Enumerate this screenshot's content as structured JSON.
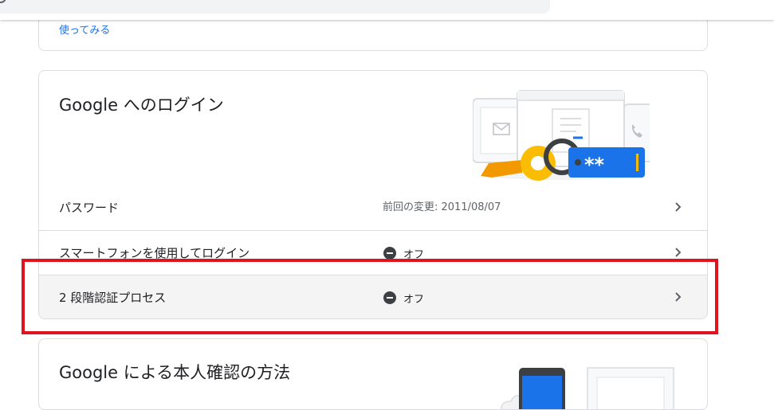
{
  "top_card": {
    "link_label": "使ってみる"
  },
  "signin_card": {
    "title": "Google へのログイン",
    "illustration_icons": [
      "mail-icon",
      "document-icon",
      "phone-icon",
      "key-icon",
      "password-field-icon"
    ],
    "password_mask": "**",
    "rows": [
      {
        "label": "パスワード",
        "value": "前回の変更: 2011/08/07"
      },
      {
        "label": "スマートフォンを使用してログイン",
        "status": "オフ",
        "status_icon": "minus-circle-icon"
      },
      {
        "label": "2 段階認証プロセス",
        "status": "オフ",
        "status_icon": "minus-circle-icon"
      }
    ]
  },
  "verify_card": {
    "title": "Google による本人確認の方法"
  },
  "colors": {
    "link": "#1a73e8",
    "border": "#dadce0",
    "highlight_row": "#f4f4f4",
    "annotation_box": "#e0141e",
    "key": "#f9ab00",
    "password_field": "#1a73e8"
  }
}
